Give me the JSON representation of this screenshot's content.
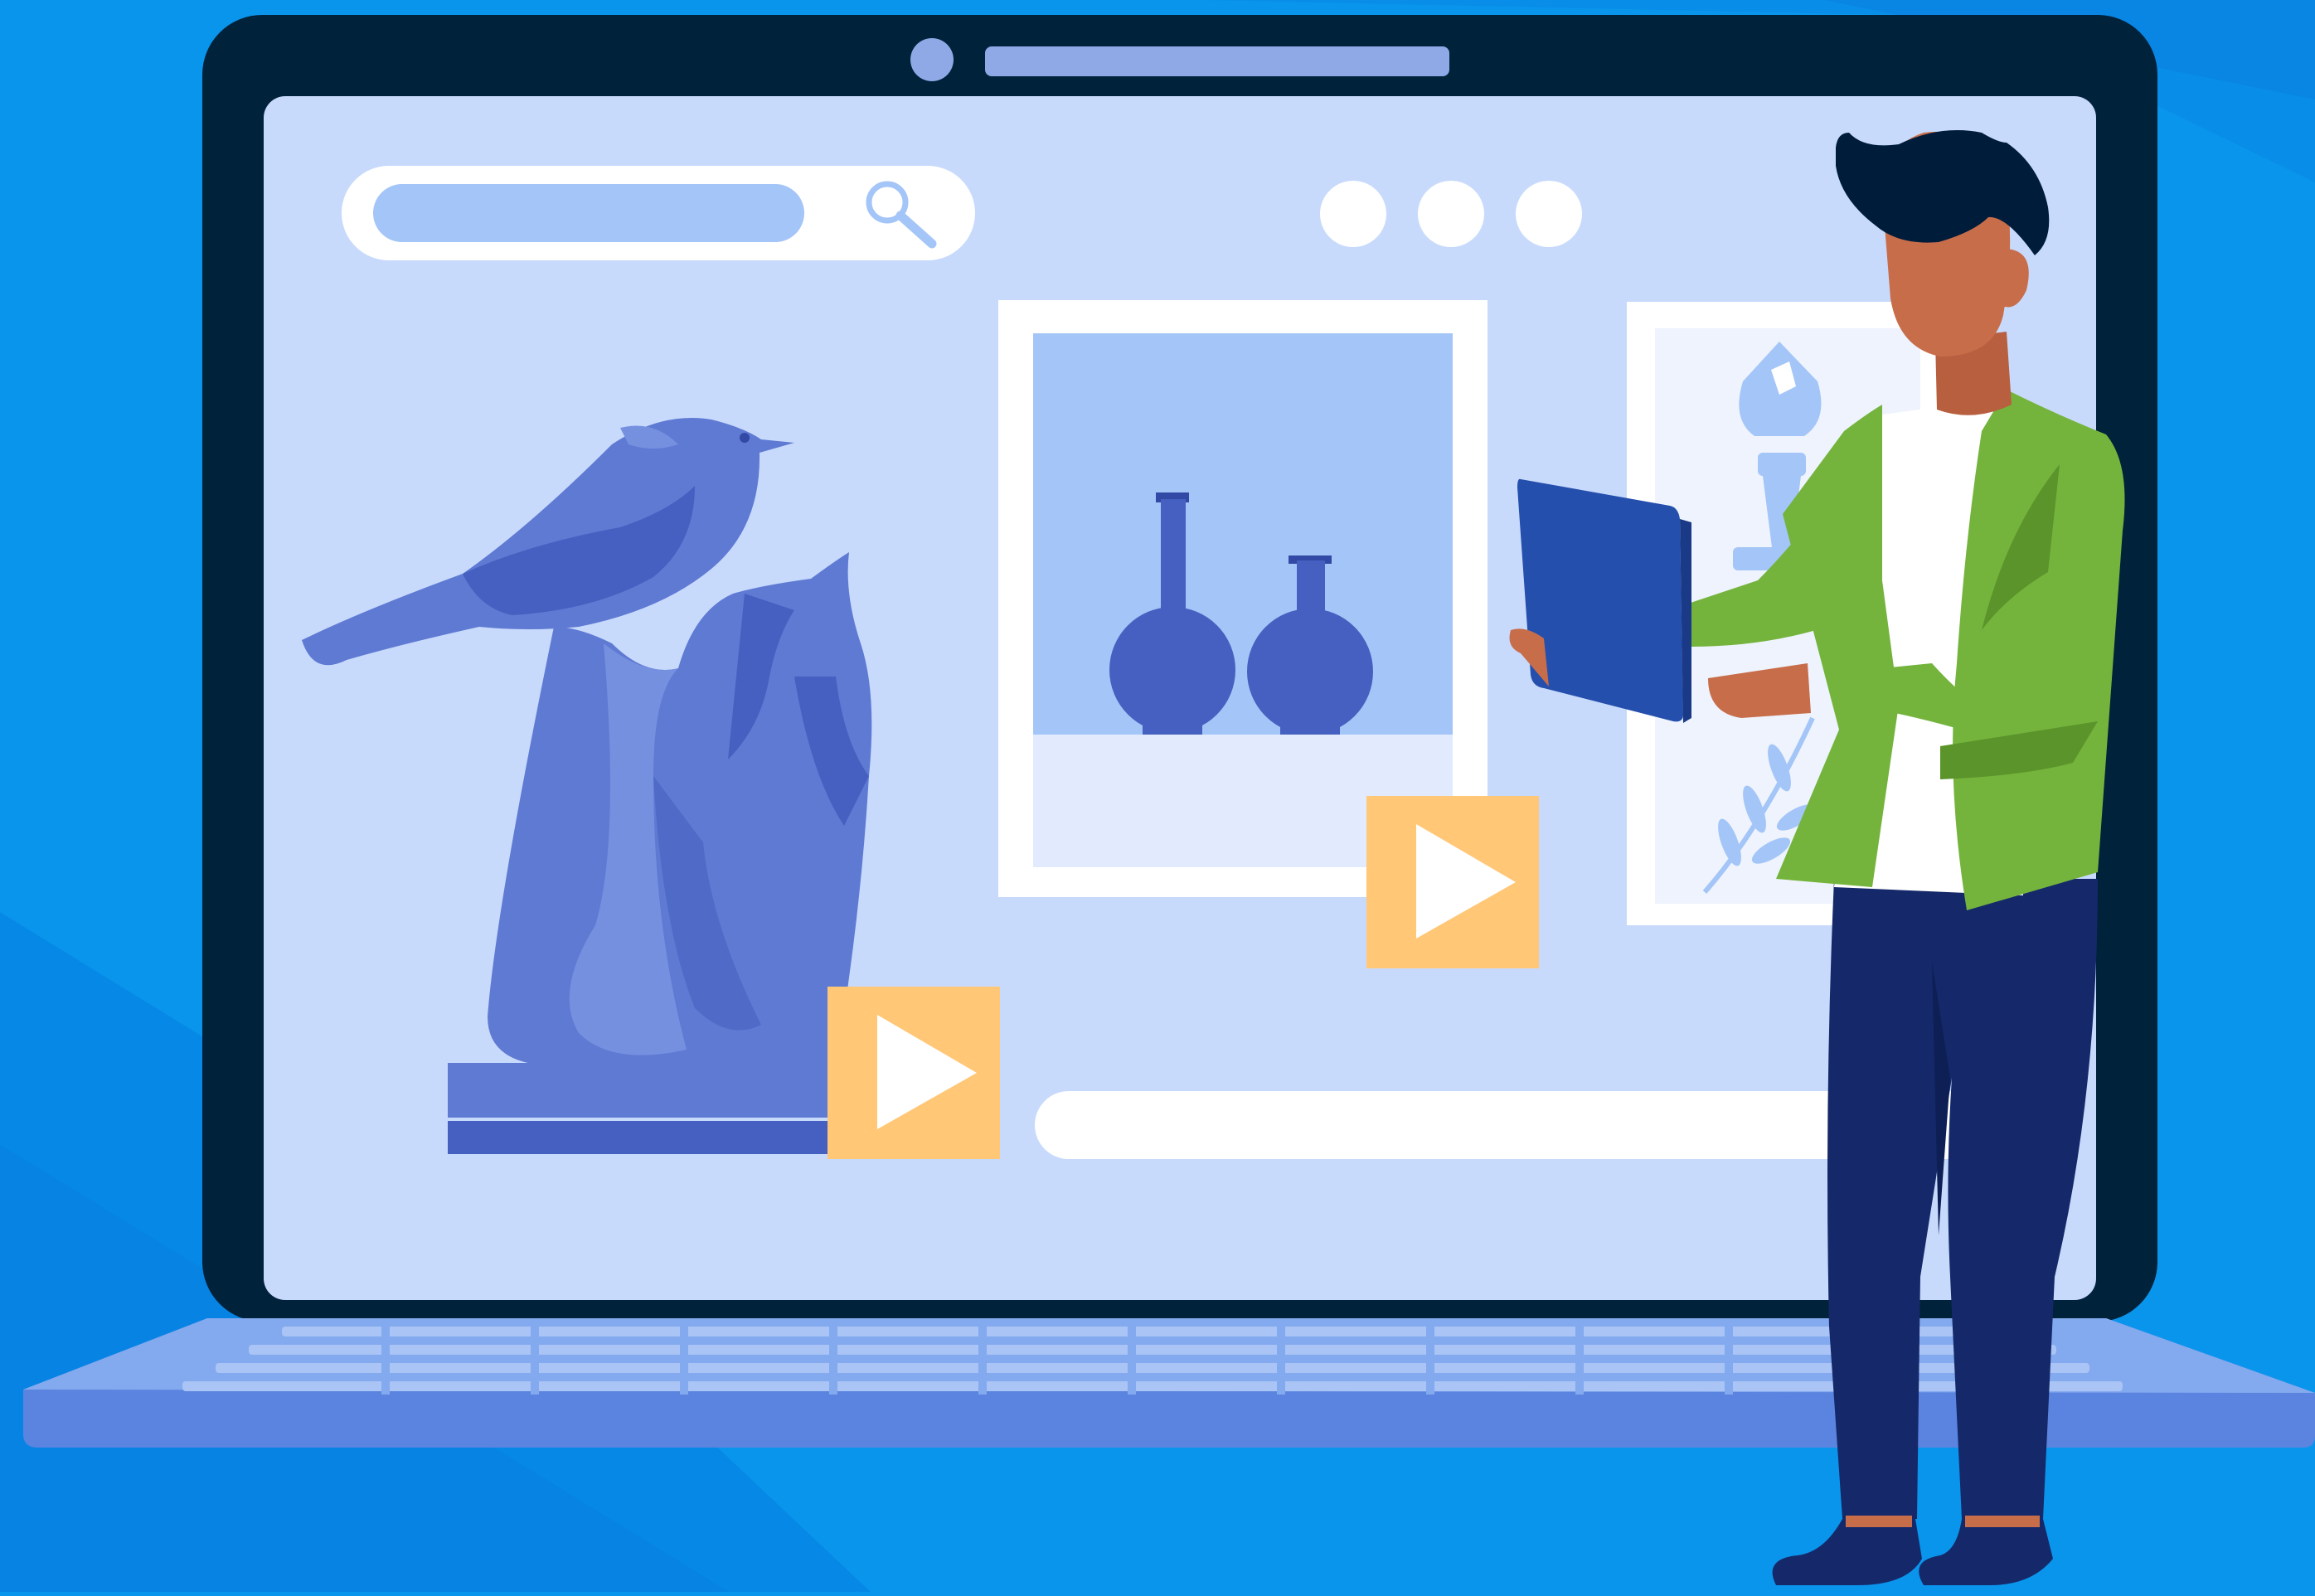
{
  "colors": {
    "background": "#0a95ec",
    "laptop_frame": "#00223b",
    "screen": "#c8dafc",
    "accent_light_blue": "#a4c5f7",
    "statue_blue": "#5f7ad3",
    "statue_dark": "#4560c0",
    "play_button": "#ffc776",
    "jacket_green": "#74b43c",
    "pants_navy": "#15296a",
    "tablet_blue": "#244fad",
    "skin": "#c86d4a"
  },
  "search": {
    "value": "",
    "placeholder": "",
    "icon": "magnifier-icon"
  },
  "window_controls": [
    "dot",
    "dot",
    "dot"
  ],
  "play_buttons": [
    {
      "icon": "play-icon"
    },
    {
      "icon": "play-icon"
    }
  ],
  "video_progress": {
    "value": 0
  },
  "exhibits": [
    {
      "subject": "bird-statue"
    },
    {
      "subject": "lab-flasks"
    },
    {
      "subject": "chess-piece"
    }
  ]
}
